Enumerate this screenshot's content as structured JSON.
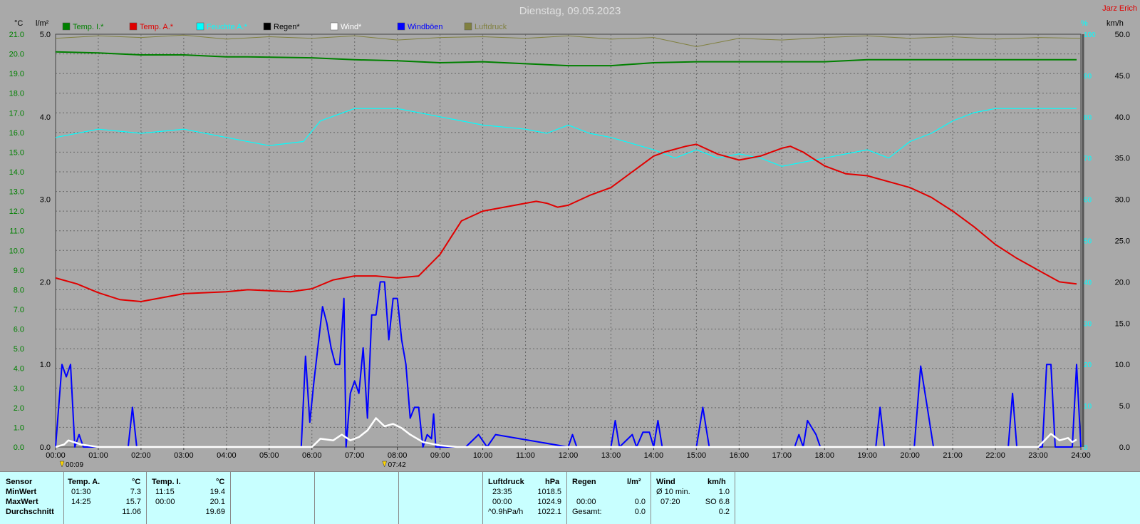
{
  "header": {
    "title": "Dienstag, 09.05.2023",
    "author": "Jarz Erich",
    "unit_temp": "°C",
    "unit_rain": "l/m²",
    "unit_humidity": "%",
    "unit_wind": "km/h"
  },
  "legend": [
    {
      "label": "Temp. I.*",
      "color": "#008000"
    },
    {
      "label": "Temp. A.*",
      "color": "#e00000"
    },
    {
      "label": "Feuchte A.*",
      "color": "#00ffff"
    },
    {
      "label": "Regen*",
      "color": "#000000"
    },
    {
      "label": "Wind*",
      "color": "#ffffff"
    },
    {
      "label": "Windböen",
      "color": "#0000ff"
    },
    {
      "label": "Luftdruck",
      "color": "#808040"
    }
  ],
  "markers": [
    {
      "label": "00:09",
      "t": 0.15
    },
    {
      "label": "07:42",
      "t": 7.7
    }
  ],
  "chart_data": {
    "type": "line",
    "title": "Dienstag, 09.05.2023",
    "x_range": [
      0,
      24
    ],
    "x_ticks": [
      "00:00",
      "01:00",
      "02:00",
      "03:00",
      "04:00",
      "05:00",
      "06:00",
      "07:00",
      "08:00",
      "09:00",
      "10:00",
      "11:00",
      "12:00",
      "13:00",
      "14:00",
      "15:00",
      "16:00",
      "17:00",
      "18:00",
      "19:00",
      "20:00",
      "21:00",
      "22:00",
      "23:00",
      "24:00"
    ],
    "axes": {
      "temp": {
        "unit": "°C",
        "range": [
          0,
          21
        ],
        "ticks": [
          "0.0",
          "1.0",
          "2.0",
          "3.0",
          "4.0",
          "5.0",
          "6.0",
          "7.0",
          "8.0",
          "9.0",
          "10.0",
          "11.0",
          "12.0",
          "13.0",
          "14.0",
          "15.0",
          "16.0",
          "17.0",
          "18.0",
          "19.0",
          "20.0",
          "21.0"
        ]
      },
      "rain": {
        "unit": "l/m²",
        "range": [
          0,
          5
        ],
        "ticks": [
          "0.0",
          "1.0",
          "2.0",
          "3.0",
          "4.0",
          "5.0"
        ]
      },
      "humidity": {
        "unit": "%",
        "range": [
          0,
          100
        ],
        "ticks": [
          "0",
          "10",
          "20",
          "30",
          "40",
          "50",
          "60",
          "70",
          "80",
          "90",
          "100"
        ]
      },
      "wind": {
        "unit": "km/h",
        "range": [
          0,
          50
        ],
        "ticks": [
          "0.0",
          "5.0",
          "10.0",
          "15.0",
          "20.0",
          "25.0",
          "30.0",
          "35.0",
          "40.0",
          "45.0",
          "50.0"
        ]
      }
    },
    "grid": true,
    "series": [
      {
        "name": "Temp. I.*",
        "axis": "temp",
        "color": "#008000",
        "x": [
          0,
          1,
          2,
          3,
          4,
          4.5,
          6,
          7,
          8,
          9,
          10,
          11,
          12,
          13,
          14,
          15,
          16,
          17,
          18,
          19,
          20,
          21,
          22,
          23,
          23.9
        ],
        "y": [
          20.1,
          20.05,
          19.95,
          19.95,
          19.85,
          19.85,
          19.8,
          19.7,
          19.65,
          19.55,
          19.6,
          19.5,
          19.4,
          19.4,
          19.55,
          19.6,
          19.6,
          19.6,
          19.6,
          19.7,
          19.7,
          19.7,
          19.7,
          19.7,
          19.7
        ]
      },
      {
        "name": "Temp. A.*",
        "axis": "temp",
        "color": "#e00000",
        "x": [
          0,
          0.5,
          1,
          1.5,
          2,
          3,
          4,
          4.5,
          5,
          5.5,
          6,
          6.5,
          7,
          7.5,
          8,
          8.5,
          9,
          9.5,
          10,
          10.5,
          11,
          11.25,
          11.5,
          11.75,
          12,
          12.5,
          13,
          13.5,
          14,
          14.25,
          14.75,
          15,
          15.5,
          16,
          16.5,
          17,
          17.2,
          17.5,
          18,
          18.5,
          19,
          19.5,
          20,
          20.5,
          21,
          21.5,
          22,
          22.5,
          23,
          23.5,
          23.9
        ],
        "y": [
          8.6,
          8.3,
          7.85,
          7.5,
          7.4,
          7.8,
          7.9,
          8.0,
          7.95,
          7.9,
          8.05,
          8.5,
          8.7,
          8.7,
          8.6,
          8.7,
          9.8,
          11.5,
          12.0,
          12.2,
          12.4,
          12.5,
          12.4,
          12.2,
          12.3,
          12.8,
          13.2,
          14.0,
          14.8,
          15.0,
          15.3,
          15.4,
          14.9,
          14.6,
          14.8,
          15.2,
          15.3,
          15.0,
          14.3,
          13.9,
          13.8,
          13.5,
          13.2,
          12.7,
          12.0,
          11.2,
          10.3,
          9.6,
          9.0,
          8.4,
          8.3
        ]
      },
      {
        "name": "Feuchte A.*",
        "axis": "humidity",
        "color": "#00ffff",
        "x": [
          0,
          1,
          2,
          3,
          4,
          5,
          5.8,
          6.2,
          7,
          8,
          9,
          10,
          11,
          11.5,
          12,
          12.5,
          13,
          14,
          14.5,
          15,
          15.5,
          16,
          16.5,
          17,
          17.5,
          18,
          18.5,
          19,
          19.5,
          20,
          20.5,
          21,
          21.5,
          22,
          23,
          23.9
        ],
        "y": [
          75,
          77,
          76,
          77,
          75,
          73,
          74,
          79,
          82,
          82,
          80,
          78,
          77,
          76,
          78,
          76,
          75,
          72,
          70,
          72,
          70,
          71,
          70,
          68,
          69,
          70,
          71,
          72,
          70,
          74,
          76,
          79,
          81,
          82,
          82,
          82
        ]
      },
      {
        "name": "Wind*",
        "axis": "wind",
        "color": "#ffffff",
        "x": [
          0,
          0.2,
          0.3,
          0.6,
          1,
          6.0,
          6.2,
          6.5,
          6.7,
          6.9,
          7.1,
          7.3,
          7.5,
          7.7,
          7.9,
          8.1,
          8.3,
          8.6,
          9.0,
          9.4,
          20.2,
          20.5,
          23.0,
          23.3,
          23.5,
          23.7,
          23.8,
          23.9
        ],
        "y": [
          0,
          0.3,
          0.8,
          0.3,
          0,
          0,
          1.0,
          0.8,
          1.5,
          0.8,
          1.2,
          2.0,
          3.5,
          2.5,
          2.8,
          2.3,
          1.5,
          0.6,
          0.2,
          0,
          0,
          0,
          0,
          1.6,
          0.8,
          1.1,
          0.6,
          0.9
        ]
      },
      {
        "name": "Windböen",
        "axis": "wind",
        "color": "#0000ff",
        "x": [
          0,
          0.15,
          0.25,
          0.35,
          0.45,
          0.55,
          0.65,
          0.75,
          1.0,
          1.7,
          1.8,
          1.9,
          2.0,
          5.75,
          5.85,
          5.95,
          6.05,
          6.25,
          6.35,
          6.45,
          6.55,
          6.65,
          6.75,
          6.8,
          6.9,
          7.0,
          7.1,
          7.2,
          7.3,
          7.4,
          7.5,
          7.6,
          7.7,
          7.8,
          7.9,
          8.0,
          8.1,
          8.2,
          8.3,
          8.4,
          8.5,
          8.6,
          8.7,
          8.8,
          8.85,
          8.9,
          9.0,
          9.3,
          9.6,
          9.9,
          10.1,
          10.3,
          12.0,
          12.1,
          12.2,
          13.0,
          13.1,
          13.2,
          13.5,
          13.6,
          13.75,
          13.9,
          14.0,
          14.1,
          14.2,
          14.3,
          15.0,
          15.15,
          15.3,
          17.3,
          17.4,
          17.5,
          17.6,
          17.8,
          17.9,
          18.0,
          19.2,
          19.3,
          19.4,
          20.1,
          20.25,
          20.4,
          20.55,
          22.3,
          22.4,
          22.5,
          23.0,
          23.1,
          23.2,
          23.3,
          23.4,
          23.5,
          23.6,
          23.7,
          23.8,
          23.9,
          24.0
        ],
        "y": [
          0,
          10,
          8.5,
          10,
          0,
          1.5,
          0,
          0,
          0,
          0,
          4.8,
          0,
          0,
          0,
          11,
          3.0,
          8.0,
          17,
          15,
          12,
          10,
          10,
          18,
          0,
          6.5,
          8.0,
          6.5,
          12,
          3.5,
          16,
          16,
          20,
          20,
          13,
          18,
          18,
          13,
          10,
          3.5,
          4.8,
          4.8,
          0,
          1.5,
          1.0,
          4.0,
          0,
          0,
          0,
          0,
          1.5,
          0,
          1.5,
          0,
          1.5,
          0,
          0,
          3.2,
          0,
          1.5,
          0,
          1.8,
          1.8,
          0,
          3.2,
          0,
          0,
          0,
          4.8,
          0,
          0,
          1.5,
          0,
          3.2,
          1.5,
          0,
          0,
          0,
          4.8,
          0,
          0,
          9.8,
          5.0,
          0,
          0,
          6.5,
          0,
          0,
          0,
          10,
          10,
          0,
          0,
          0,
          0,
          0,
          10,
          0
        ]
      }
    ],
    "pressure_trace": {
      "name": "Luftdruck",
      "axis": "wind",
      "color": "#808040",
      "x": [
        0,
        1,
        2,
        3,
        4,
        5,
        6,
        7,
        8,
        9,
        10,
        11,
        12,
        13,
        14,
        15,
        16,
        17,
        18,
        19,
        20,
        21,
        22,
        23,
        24
      ],
      "y": [
        49.5,
        49.8,
        49.6,
        49.9,
        49.4,
        49.7,
        49.5,
        49.8,
        49.3,
        49.6,
        49.7,
        49.5,
        49.8,
        49.4,
        49.6,
        48.5,
        49.5,
        49.3,
        49.6,
        49.8,
        49.5,
        49.7,
        49.4,
        49.6,
        49.5
      ]
    }
  },
  "stats": {
    "sensor_header": "Sensor",
    "row_labels": [
      "MinWert",
      "MaxWert",
      "Durchschnitt"
    ],
    "temp_a": {
      "header": "Temp. A.",
      "unit": "°C",
      "min_time": "01:30",
      "min_val": "7.3",
      "max_time": "14:25",
      "max_val": "15.7",
      "avg": "11.06"
    },
    "temp_i": {
      "header": "Temp. I.",
      "unit": "°C",
      "min_time": "11:15",
      "min_val": "19.4",
      "max_time": "00:00",
      "max_val": "20.1",
      "avg": "19.69"
    },
    "pressure": {
      "header": "Luftdruck",
      "unit": "hPa",
      "r1a": "23:35",
      "r1b": "1018.5",
      "r2a": "00:00",
      "r2b": "1024.9",
      "r3a": "^0.9hPa/h",
      "r3b": "1022.1"
    },
    "rain": {
      "header": "Regen",
      "unit": "l/m²",
      "r2a": "00:00",
      "r2b": "0.0",
      "r3a": "Gesamt:",
      "r3b": "0.0"
    },
    "wind": {
      "header": "Wind",
      "unit": "km/h",
      "r1a": "Ø 10 min.",
      "r1b": "1.0",
      "r2a": "07:20",
      "r2b": "SO 6.8",
      "r3b": "0.2"
    }
  }
}
